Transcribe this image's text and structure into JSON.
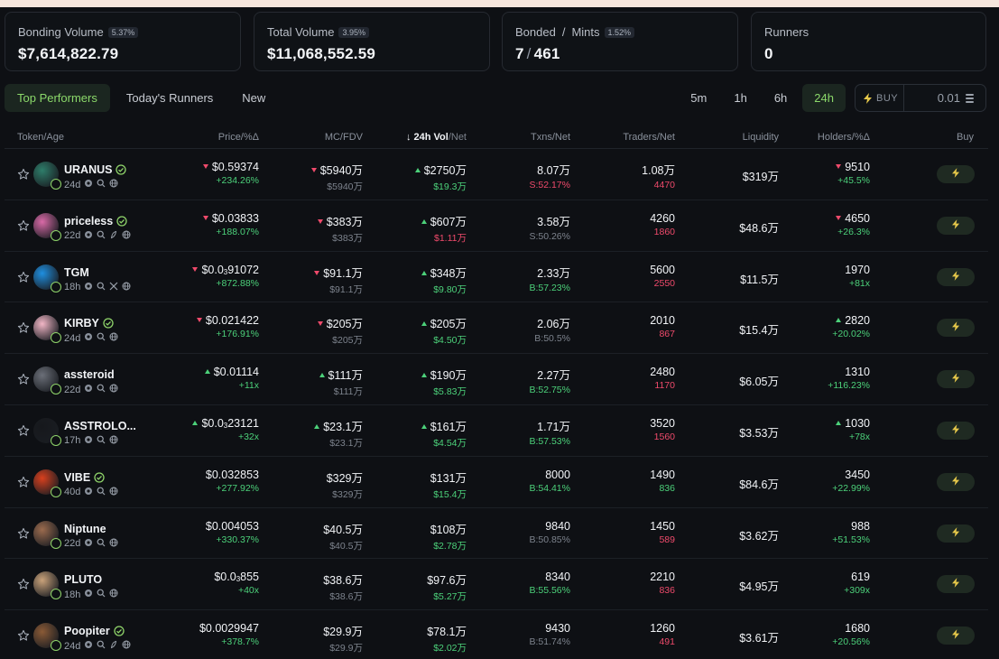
{
  "stats": [
    {
      "label": "Bonding Volume",
      "badge": "5.37%",
      "value": "$7,614,822.79"
    },
    {
      "label": "Total Volume",
      "badge": "3.95%",
      "value": "$11,068,552.59"
    },
    {
      "label_a": "Bonded",
      "label_sep": "/",
      "label_b": "Mints",
      "badge": "1.52%",
      "value_a": "7",
      "value_sep": "/",
      "value_b": "461"
    },
    {
      "label": "Runners",
      "value": "0"
    }
  ],
  "tabs": [
    "Top Performers",
    "Today's Runners",
    "New"
  ],
  "timeframes": [
    "5m",
    "1h",
    "6h",
    "24h"
  ],
  "buy": {
    "label": "BUY",
    "amount": "0.01"
  },
  "headers": {
    "token": "Token/Age",
    "price": "Price/%Δ",
    "mc": "MC/FDV",
    "vol_arrow": "↓",
    "vol_main": "24h Vol",
    "vol_rest": "/Net",
    "txns": "Txns/Net",
    "traders": "Traders/Net",
    "liquidity": "Liquidity",
    "holders": "Holders/%Δ",
    "buy": "Buy"
  },
  "rows": [
    {
      "name": "URANUS",
      "verified": true,
      "age": "24d",
      "social": "web",
      "avatar": "#2e7d6a",
      "price": "$0.59374",
      "price_dir": "down",
      "price_pct": "+234.26%",
      "mc": "$5940万",
      "mc_dir": "down",
      "fdv": "$5940万",
      "vol": "$2750万",
      "vol_dir": "up",
      "vol_net": "$19.3万",
      "vol_net_color": "green",
      "txns": "8.07万",
      "txns_net": "S:52.17%",
      "txns_color": "red",
      "traders": "1.08万",
      "traders_net": "4470",
      "traders_color": "red",
      "liquidity": "$319万",
      "holders": "9510",
      "holders_dir": "down",
      "holders_pct": "+45.5%"
    },
    {
      "name": "priceless",
      "verified": true,
      "age": "22d",
      "social": "pump",
      "avatar": "#d96aa7",
      "price": "$0.03833",
      "price_dir": "down",
      "price_pct": "+188.07%",
      "mc": "$383万",
      "mc_dir": "down",
      "fdv": "$383万",
      "vol": "$607万",
      "vol_dir": "up",
      "vol_net": "$1.11万",
      "vol_net_color": "red",
      "txns": "3.58万",
      "txns_net": "S:50.26%",
      "txns_color": "muted",
      "traders": "4260",
      "traders_net": "1860",
      "traders_color": "red",
      "liquidity": "$48.6万",
      "holders": "4650",
      "holders_dir": "down",
      "holders_pct": "+26.3%"
    },
    {
      "name": "TGM",
      "verified": false,
      "age": "18h",
      "social": "x",
      "avatar": "#1f8fe0",
      "price_main": "$0.0",
      "price_sub": "3",
      "price_tail": "91072",
      "price_dir": "down",
      "price_pct": "+872.88%",
      "mc": "$91.1万",
      "mc_dir": "down",
      "fdv": "$91.1万",
      "vol": "$348万",
      "vol_dir": "up",
      "vol_net": "$9.80万",
      "vol_net_color": "green",
      "txns": "2.33万",
      "txns_net": "B:57.23%",
      "txns_color": "green",
      "traders": "5600",
      "traders_net": "2550",
      "traders_color": "red",
      "liquidity": "$11.5万",
      "holders": "1970",
      "holders_dir": "",
      "holders_pct": "+81x"
    },
    {
      "name": "KIRBY",
      "verified": true,
      "age": "24d",
      "social": "web",
      "avatar": "#f2b6c6",
      "price": "$0.021422",
      "price_dir": "down",
      "price_pct": "+176.91%",
      "mc": "$205万",
      "mc_dir": "down",
      "fdv": "$205万",
      "vol": "$205万",
      "vol_dir": "up",
      "vol_net": "$4.50万",
      "vol_net_color": "green",
      "txns": "2.06万",
      "txns_net": "B:50.5%",
      "txns_color": "muted",
      "traders": "2010",
      "traders_net": "867",
      "traders_color": "red",
      "liquidity": "$15.4万",
      "holders": "2820",
      "holders_dir": "up",
      "holders_pct": "+20.02%"
    },
    {
      "name": "assteroid",
      "verified": false,
      "age": "22d",
      "social": "web",
      "avatar": "#6b6f78",
      "price": "$0.01114",
      "price_dir": "up",
      "price_pct": "+11x",
      "mc": "$111万",
      "mc_dir": "up",
      "fdv": "$111万",
      "vol": "$190万",
      "vol_dir": "up",
      "vol_net": "$5.83万",
      "vol_net_color": "green",
      "txns": "2.27万",
      "txns_net": "B:52.75%",
      "txns_color": "green",
      "traders": "2480",
      "traders_net": "1170",
      "traders_color": "red",
      "liquidity": "$6.05万",
      "holders": "1310",
      "holders_dir": "",
      "holders_pct": "+116.23%"
    },
    {
      "name": "ASSTROLO...",
      "verified": false,
      "age": "17h",
      "social": "web",
      "avatar": "#16181c",
      "price_main": "$0.0",
      "price_sub": "3",
      "price_tail": "23121",
      "price_dir": "up",
      "price_pct": "+32x",
      "mc": "$23.1万",
      "mc_dir": "up",
      "fdv": "$23.1万",
      "vol": "$161万",
      "vol_dir": "up",
      "vol_net": "$4.54万",
      "vol_net_color": "green",
      "txns": "1.71万",
      "txns_net": "B:57.53%",
      "txns_color": "green",
      "traders": "3520",
      "traders_net": "1560",
      "traders_color": "red",
      "liquidity": "$3.53万",
      "holders": "1030",
      "holders_dir": "up",
      "holders_pct": "+78x"
    },
    {
      "name": "VIBE",
      "verified": true,
      "age": "40d",
      "social": "web",
      "avatar": "#d8401e",
      "price": "$0.032853",
      "price_dir": "",
      "price_pct": "+277.92%",
      "mc": "$329万",
      "mc_dir": "",
      "fdv": "$329万",
      "vol": "$131万",
      "vol_dir": "",
      "vol_net": "$15.4万",
      "vol_net_color": "green",
      "txns": "8000",
      "txns_net": "B:54.41%",
      "txns_color": "green",
      "traders": "1490",
      "traders_net": "836",
      "traders_color": "green",
      "liquidity": "$84.6万",
      "holders": "3450",
      "holders_dir": "",
      "holders_pct": "+22.99%"
    },
    {
      "name": "Niptune",
      "verified": false,
      "age": "22d",
      "social": "web",
      "avatar": "#9b6b4e",
      "price": "$0.004053",
      "price_dir": "",
      "price_pct": "+330.37%",
      "mc": "$40.5万",
      "mc_dir": "",
      "fdv": "$40.5万",
      "vol": "$108万",
      "vol_dir": "",
      "vol_net": "$2.78万",
      "vol_net_color": "green",
      "txns": "9840",
      "txns_net": "B:50.85%",
      "txns_color": "muted",
      "traders": "1450",
      "traders_net": "589",
      "traders_color": "red",
      "liquidity": "$3.62万",
      "holders": "988",
      "holders_dir": "",
      "holders_pct": "+51.53%"
    },
    {
      "name": "PLUTO",
      "verified": false,
      "age": "18h",
      "social": "web",
      "avatar": "#c9a27a",
      "price_main": "$0.0",
      "price_sub": "3",
      "price_tail": "855",
      "price_dir": "",
      "price_pct": "+40x",
      "mc": "$38.6万",
      "mc_dir": "",
      "fdv": "$38.6万",
      "vol": "$97.6万",
      "vol_dir": "",
      "vol_net": "$5.27万",
      "vol_net_color": "green",
      "txns": "8340",
      "txns_net": "B:55.56%",
      "txns_color": "green",
      "traders": "2210",
      "traders_net": "836",
      "traders_color": "red",
      "liquidity": "$4.95万",
      "holders": "619",
      "holders_dir": "",
      "holders_pct": "+309x"
    },
    {
      "name": "Poopiter",
      "verified": true,
      "age": "24d",
      "social": "pump",
      "avatar": "#8a5a36",
      "price": "$0.0029947",
      "price_dir": "",
      "price_pct": "+378.7%",
      "mc": "$29.9万",
      "mc_dir": "",
      "fdv": "$29.9万",
      "vol": "$78.1万",
      "vol_dir": "",
      "vol_net": "$2.02万",
      "vol_net_color": "green",
      "txns": "9430",
      "txns_net": "B:51.74%",
      "txns_color": "muted",
      "traders": "1260",
      "traders_net": "491",
      "traders_color": "red",
      "liquidity": "$3.61万",
      "holders": "1680",
      "holders_dir": "",
      "holders_pct": "+20.56%"
    }
  ],
  "colors": {
    "green": "#4cd17a",
    "red": "#ef4a6b",
    "accent": "#8bd86a"
  }
}
